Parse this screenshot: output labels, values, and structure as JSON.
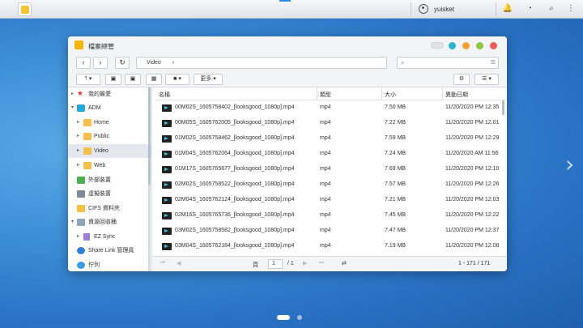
{
  "taskbar": {
    "username": "yuisket"
  },
  "window": {
    "title": "檔案總管",
    "path": "Video",
    "path_arrow": "›",
    "more_label": "更多",
    "colors": {
      "close": "#f05a5a",
      "maximize": "#8dc63f",
      "restore": "#f7a134",
      "help": "#23b7c8"
    }
  },
  "sidebar": {
    "items": [
      {
        "label": "我的最愛",
        "icon": "star-icon"
      },
      {
        "label": "ADM",
        "icon": "adm-icon"
      },
      {
        "label": "Home",
        "icon": "folder-icon"
      },
      {
        "label": "Public",
        "icon": "folder-icon"
      },
      {
        "label": "Video",
        "icon": "folder-icon"
      },
      {
        "label": "Web",
        "icon": "folder-icon"
      },
      {
        "label": "外部裝置",
        "icon": "external-device-icon"
      },
      {
        "label": "虛擬裝置",
        "icon": "virtual-device-icon"
      },
      {
        "label": "CIFS 資料夾",
        "icon": "cifs-folder-icon"
      },
      {
        "label": "資源回收桶",
        "icon": "recycle-bin-icon"
      },
      {
        "label": "EZ Sync",
        "icon": "ez-sync-icon"
      },
      {
        "label": "Share Link 管理員",
        "icon": "share-link-icon"
      },
      {
        "label": "佇列",
        "icon": "queue-icon"
      }
    ]
  },
  "list": {
    "headers": {
      "name": "名稱",
      "type": "類型",
      "size": "大小",
      "modified": "異動日期"
    },
    "rows": [
      {
        "name": "00M02S_1605758402_[looksgood_1080p].mp4",
        "type": "mp4",
        "size": "7.50 MB",
        "modified": "11/20/2020 PM 12:35"
      },
      {
        "name": "00M05S_1605762005_[looksgood_1080p].mp4",
        "type": "mp4",
        "size": "7.22 MB",
        "modified": "11/20/2020 PM 12:01"
      },
      {
        "name": "01M02S_1605758462_[looksgood_1080p].mp4",
        "type": "mp4",
        "size": "7.59 MB",
        "modified": "11/20/2020 PM 12:29"
      },
      {
        "name": "01M04S_1605762064_[looksgood_1080p].mp4",
        "type": "mp4",
        "size": "7.24 MB",
        "modified": "11/20/2020 AM 11:56"
      },
      {
        "name": "01M17S_1605765677_[looksgood_1080p].mp4",
        "type": "mp4",
        "size": "7.69 MB",
        "modified": "11/20/2020 PM 12:10"
      },
      {
        "name": "02M02S_1605758522_[looksgood_1080p].mp4",
        "type": "mp4",
        "size": "7.57 MB",
        "modified": "11/20/2020 PM 12:26"
      },
      {
        "name": "02M04S_1605762124_[looksgood_1080p].mp4",
        "type": "mp4",
        "size": "7.21 MB",
        "modified": "11/20/2020 PM 12:03"
      },
      {
        "name": "02M16S_1605765736_[looksgood_1080p].mp4",
        "type": "mp4",
        "size": "7.45 MB",
        "modified": "11/20/2020 PM 12:22"
      },
      {
        "name": "03M02S_1605758582_[looksgood_1080p].mp4",
        "type": "mp4",
        "size": "7.47 MB",
        "modified": "11/20/2020 PM 12:37"
      },
      {
        "name": "03M04S_1605762184_[looksgood_1080p].mp4",
        "type": "mp4",
        "size": "7.19 MB",
        "modified": "11/20/2020 PM 12:08"
      }
    ]
  },
  "pager": {
    "page_label": "頁",
    "current_page": "1",
    "total_pages": "/ 1",
    "range": "1 - 171 / 171"
  },
  "desktop": {
    "next_arrow": "›"
  }
}
